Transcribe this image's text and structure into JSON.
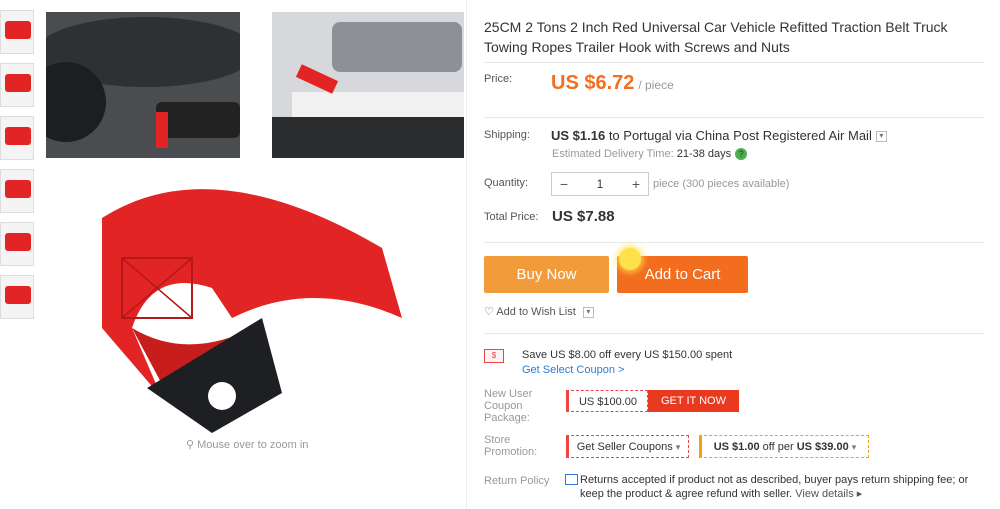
{
  "thumbnails": 6,
  "gallery": {
    "zoom_hint": "Mouse over to zoom in"
  },
  "product": {
    "title": "25CM 2 Tons 2 Inch Red Universal Car Vehicle Refitted Traction Belt Truck Towing Ropes Trailer Hook with Screws and Nuts",
    "price_label": "Price:",
    "price": "US $6.72",
    "price_unit": "/ piece",
    "shipping_label": "Shipping:",
    "shipping_cost": "US $1.16",
    "shipping_text": " to Portugal via China Post Registered Air Mail",
    "est_label": "Estimated Delivery Time:",
    "est_value": "21-38 days",
    "quantity_label": "Quantity:",
    "quantity_value": "1",
    "availability": "piece (300 pieces available)",
    "total_label": "Total Price:",
    "total": "US $7.88",
    "buy_now": "Buy Now",
    "add_to_cart": "Add to Cart",
    "wish_list": "Add to Wish List"
  },
  "promo": {
    "save_text": "Save US $8.00 off every US $150.00 spent",
    "coupon_link": "Get Select Coupon >",
    "new_user_label": "New User Coupon Package:",
    "new_user_coupon": "US $100.00",
    "get_it_now": "GET IT NOW",
    "store_promo_label": "Store Promotion:",
    "seller_coupons": "Get Seller Coupons",
    "offer_amount": "US $1.00",
    "offer_mid": " off per ",
    "offer_threshold": "US $39.00",
    "return_label": "Return Policy",
    "return_text": "Returns accepted if product not as described, buyer pays return shipping fee; or keep the product & agree refund with seller.",
    "view_details": "View details"
  },
  "colors": {
    "price": "#f36e1e",
    "buy_now": "#f29b3b",
    "add_to_cart": "#f36d1e",
    "link": "#2e7bd6"
  }
}
